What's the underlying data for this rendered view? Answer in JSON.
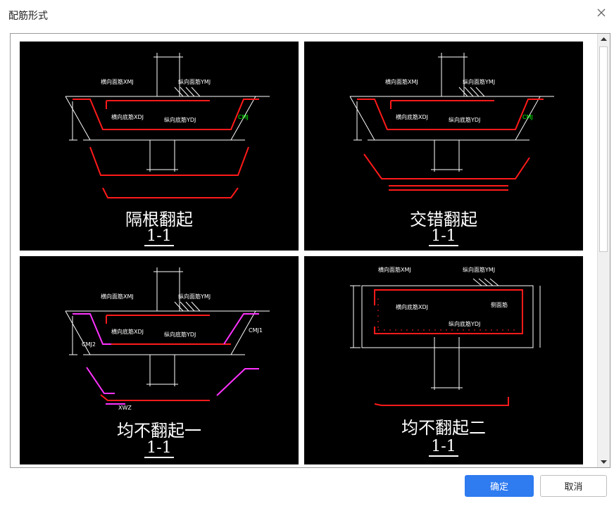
{
  "dialog": {
    "title": "配筋形式",
    "close_icon": "close-icon",
    "confirm_label": "确定",
    "cancel_label": "取消",
    "accent_color": "#2f7bf0"
  },
  "options": [
    {
      "title": "隔根翻起",
      "section": "1-1"
    },
    {
      "title": "交错翻起",
      "section": "1-1"
    },
    {
      "title": "均不翻起一",
      "section": "1-1"
    },
    {
      "title": "均不翻起二",
      "section": "1-1"
    }
  ],
  "drawing_labels": {
    "transverse_top": "横向面筋XMJ",
    "longitudinal_top": "纵向面筋YMJ",
    "transverse_bottom": "横向底筋XDJ",
    "longitudinal_bottom": "纵向底筋YDJ",
    "cmj": "CMJ",
    "cmj1": "CMJ1",
    "cmj2": "CMJ2",
    "xwz": "XWZ",
    "side": "侧面筋"
  }
}
